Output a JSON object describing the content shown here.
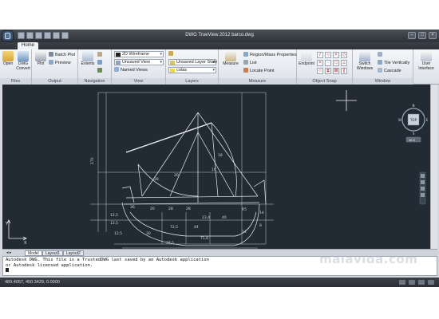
{
  "window": {
    "title": "DWG TrueView 2012    barco.dwg"
  },
  "ribbon": {
    "tabs": [
      "Home"
    ],
    "files": {
      "open": "Open",
      "dwg_convert": "DWG Convert",
      "label": "Files"
    },
    "output": {
      "plot": "Plot",
      "batch_plot": "Batch Plot",
      "preview": "Preview",
      "label": "Output"
    },
    "navigation": {
      "extents": "Extents",
      "label": "Navigation"
    },
    "view": {
      "visual_style": "2D Wireframe",
      "saved_view": "Unsaved View",
      "named_views": "Named Views",
      "label": "View"
    },
    "layers": {
      "layer_state": "Unsaved Layer State",
      "current_layer": "cotas",
      "label": "Layers"
    },
    "measure": {
      "measure": "Measure",
      "region_mass": "Region/Mass Properties",
      "list": "List",
      "locate_point": "Locate Point",
      "label": "Measure"
    },
    "object_snap": {
      "endpoint": "Endpoint",
      "label": "Object Snap"
    },
    "window_panel": {
      "switch_windows": "Switch Windows",
      "tile_vertically": "Tile Vertically",
      "cascade": "Cascade",
      "label": "Window"
    },
    "user_interface": "User Interface"
  },
  "viewcube": {
    "top": "TOP",
    "n": "N",
    "s": "S",
    "e": "E",
    "w": "W",
    "wcs": "WCS"
  },
  "canvas": {
    "ucs_y": "Y",
    "ucs_x": "X",
    "dims": [
      "170",
      "12,5",
      "12,5",
      "36",
      "20",
      "28",
      "28",
      "16",
      "18",
      "23,4",
      "40",
      "R5",
      "72,5",
      "44",
      "30",
      "71,8",
      "14",
      "37,5",
      "12,5",
      "8",
      "14",
      "28",
      "20"
    ]
  },
  "layouts": [
    "Model",
    "Layout1",
    "Layout2"
  ],
  "command": {
    "lines": [
      "Autodesk DWG.  This file is a TrustedDWG last saved by an Autodesk application",
      "or Autodesk licensed application."
    ]
  },
  "status": {
    "coords": "489.4057, 450.3429, 0.0000"
  },
  "watermark": "malavida.com"
}
